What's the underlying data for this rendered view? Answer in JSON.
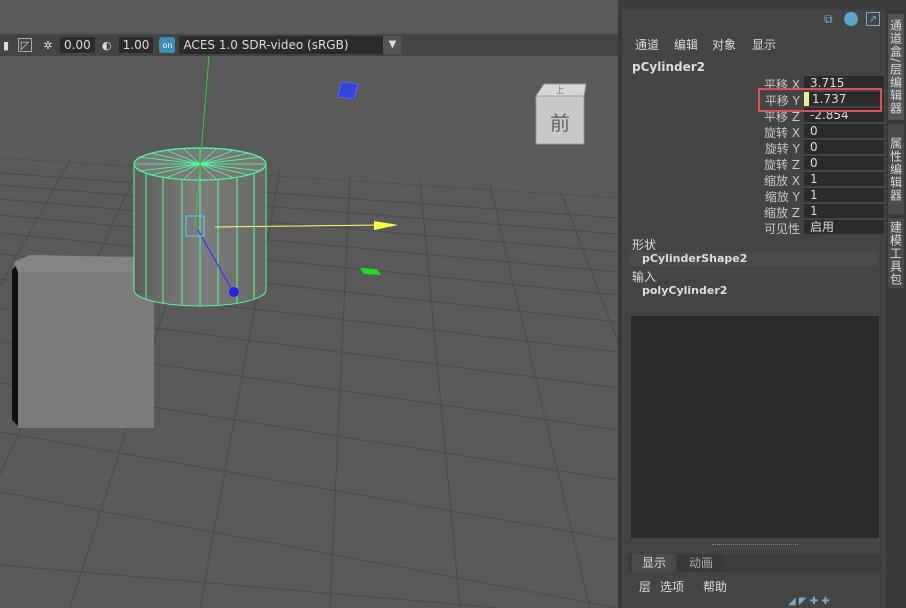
{
  "toolbar": {
    "exposure_value": "0.00",
    "gamma_value": "1.00",
    "colorspace": "ACES 1.0 SDR-video (sRGB)"
  },
  "viewcube": {
    "face_label": "前",
    "top_label": "上"
  },
  "panel_menu": [
    "通道",
    "编辑",
    "对象",
    "显示"
  ],
  "object_name": "pCylinder2",
  "attributes": [
    {
      "label": "平移 X",
      "value": "3.715"
    },
    {
      "label": "平移 Y",
      "value": "1.737"
    },
    {
      "label": "平移 Z",
      "value": "-2.854"
    },
    {
      "label": "旋转 X",
      "value": "0"
    },
    {
      "label": "旋转 Y",
      "value": "0"
    },
    {
      "label": "旋转 Z",
      "value": "0"
    },
    {
      "label": "缩放 X",
      "value": "1"
    },
    {
      "label": "缩放 Y",
      "value": "1"
    },
    {
      "label": "缩放 Z",
      "value": "1"
    },
    {
      "label": "可见性",
      "value": "启用"
    }
  ],
  "shapes_header": "形状",
  "shape_name": "pCylinderShape2",
  "inputs_header": "输入",
  "input_name": "polyCylinder2",
  "layer_tabs": [
    "显示",
    "动画"
  ],
  "layer_menu": [
    "层",
    "选项",
    "帮助"
  ],
  "side_tabs": [
    "通道盒/层编辑器",
    "属性编辑器",
    "建模工具包"
  ],
  "colors": {
    "highlight": "#e05050",
    "wire": "#4dff9a",
    "manip_x": "#ffff66",
    "manip_y": "#33cc33",
    "manip_z": "#3333ff"
  }
}
